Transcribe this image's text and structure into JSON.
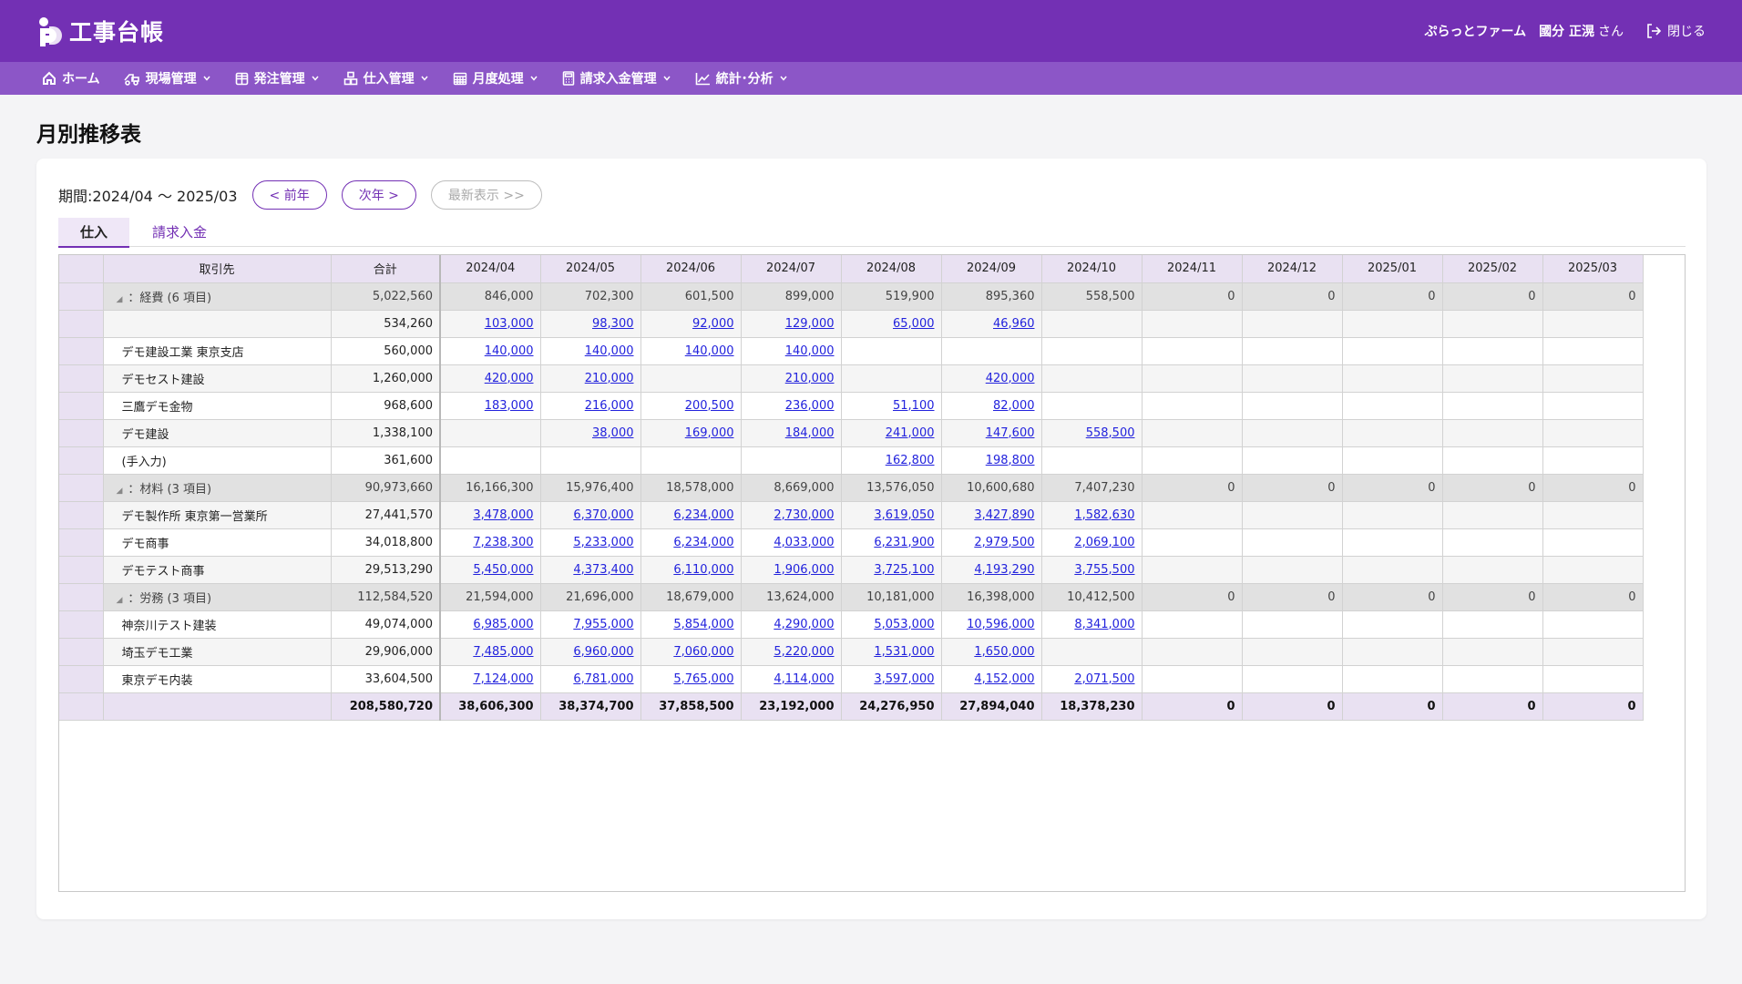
{
  "app": {
    "title": "工事台帳"
  },
  "user": {
    "company": "ぷらっとファーム",
    "name": "國分 正滉",
    "honorific": "さん",
    "logout_label": "閉じる"
  },
  "nav": [
    {
      "label": "ホーム",
      "icon": "home-icon",
      "has_menu": false
    },
    {
      "label": "現場管理",
      "icon": "truck-icon",
      "has_menu": true
    },
    {
      "label": "発注管理",
      "icon": "grid-icon",
      "has_menu": true
    },
    {
      "label": "仕入管理",
      "icon": "boxes-icon",
      "has_menu": true
    },
    {
      "label": "月度処理",
      "icon": "calendar-icon",
      "has_menu": true
    },
    {
      "label": "請求入金管理",
      "icon": "calculator-icon",
      "has_menu": true
    },
    {
      "label": "統計･分析",
      "icon": "chart-icon",
      "has_menu": true
    }
  ],
  "page": {
    "title": "月別推移表"
  },
  "controls": {
    "period": "期間:2024/04 ～ 2025/03",
    "prev_year": "< 前年",
    "next_year": "次年 >",
    "latest": "最新表示 >>"
  },
  "tabs": [
    {
      "label": "仕入",
      "active": true
    },
    {
      "label": "請求入金",
      "active": false
    }
  ],
  "table": {
    "headers": [
      "取引先",
      "合計",
      "2024/04",
      "2024/05",
      "2024/06",
      "2024/07",
      "2024/08",
      "2024/09",
      "2024/10",
      "2024/11",
      "2024/12",
      "2025/01",
      "2025/02",
      "2025/03"
    ],
    "rows": [
      {
        "type": "group",
        "name": "：経費 (6 項目)",
        "total": "5,022,560",
        "months": [
          "846,000",
          "702,300",
          "601,500",
          "899,000",
          "519,900",
          "895,360",
          "558,500",
          "0",
          "0",
          "0",
          "0",
          "0"
        ]
      },
      {
        "type": "item",
        "name": "",
        "total": "534,260",
        "months": [
          "103,000",
          "98,300",
          "92,000",
          "129,000",
          "65,000",
          "46,960",
          "",
          "",
          "",
          "",
          "",
          ""
        ]
      },
      {
        "type": "item",
        "name": "デモ建設工業 東京支店",
        "total": "560,000",
        "months": [
          "140,000",
          "140,000",
          "140,000",
          "140,000",
          "",
          "",
          "",
          "",
          "",
          "",
          "",
          ""
        ]
      },
      {
        "type": "item",
        "name": "デモセスト建設",
        "total": "1,260,000",
        "months": [
          "420,000",
          "210,000",
          "",
          "210,000",
          "",
          "420,000",
          "",
          "",
          "",
          "",
          "",
          ""
        ]
      },
      {
        "type": "item",
        "name": "三鷹デモ金物",
        "total": "968,600",
        "months": [
          "183,000",
          "216,000",
          "200,500",
          "236,000",
          "51,100",
          "82,000",
          "",
          "",
          "",
          "",
          "",
          ""
        ]
      },
      {
        "type": "item",
        "name": "デモ建設",
        "total": "1,338,100",
        "months": [
          "",
          "38,000",
          "169,000",
          "184,000",
          "241,000",
          "147,600",
          "558,500",
          "",
          "",
          "",
          "",
          ""
        ]
      },
      {
        "type": "item",
        "name": "(手入力)",
        "total": "361,600",
        "months": [
          "",
          "",
          "",
          "",
          "162,800",
          "198,800",
          "",
          "",
          "",
          "",
          "",
          ""
        ]
      },
      {
        "type": "group",
        "name": "：材料 (3 項目)",
        "total": "90,973,660",
        "months": [
          "16,166,300",
          "15,976,400",
          "18,578,000",
          "8,669,000",
          "13,576,050",
          "10,600,680",
          "7,407,230",
          "0",
          "0",
          "0",
          "0",
          "0"
        ]
      },
      {
        "type": "item",
        "name": "デモ製作所 東京第一営業所",
        "total": "27,441,570",
        "months": [
          "3,478,000",
          "6,370,000",
          "6,234,000",
          "2,730,000",
          "3,619,050",
          "3,427,890",
          "1,582,630",
          "",
          "",
          "",
          "",
          ""
        ]
      },
      {
        "type": "item",
        "name": "デモ商事",
        "total": "34,018,800",
        "months": [
          "7,238,300",
          "5,233,000",
          "6,234,000",
          "4,033,000",
          "6,231,900",
          "2,979,500",
          "2,069,100",
          "",
          "",
          "",
          "",
          ""
        ]
      },
      {
        "type": "item",
        "name": "デモテスト商事",
        "total": "29,513,290",
        "months": [
          "5,450,000",
          "4,373,400",
          "6,110,000",
          "1,906,000",
          "3,725,100",
          "4,193,290",
          "3,755,500",
          "",
          "",
          "",
          "",
          ""
        ]
      },
      {
        "type": "group",
        "name": "：労務 (3 項目)",
        "total": "112,584,520",
        "months": [
          "21,594,000",
          "21,696,000",
          "18,679,000",
          "13,624,000",
          "10,181,000",
          "16,398,000",
          "10,412,500",
          "0",
          "0",
          "0",
          "0",
          "0"
        ]
      },
      {
        "type": "item",
        "name": "神奈川テスト建装",
        "total": "49,074,000",
        "months": [
          "6,985,000",
          "7,955,000",
          "5,854,000",
          "4,290,000",
          "5,053,000",
          "10,596,000",
          "8,341,000",
          "",
          "",
          "",
          "",
          ""
        ]
      },
      {
        "type": "item",
        "name": "埼玉デモ工業",
        "total": "29,906,000",
        "months": [
          "7,485,000",
          "6,960,000",
          "7,060,000",
          "5,220,000",
          "1,531,000",
          "1,650,000",
          "",
          "",
          "",
          "",
          "",
          ""
        ]
      },
      {
        "type": "item",
        "name": "東京デモ内装",
        "total": "33,604,500",
        "months": [
          "7,124,000",
          "6,781,000",
          "5,765,000",
          "4,114,000",
          "3,597,000",
          "4,152,000",
          "2,071,500",
          "",
          "",
          "",
          "",
          ""
        ]
      },
      {
        "type": "total",
        "name": "",
        "total": "208,580,720",
        "months": [
          "38,606,300",
          "38,374,700",
          "37,858,500",
          "23,192,000",
          "24,276,950",
          "27,894,040",
          "18,378,230",
          "0",
          "0",
          "0",
          "0",
          "0"
        ]
      }
    ]
  },
  "colors": {
    "header": "#7330b4",
    "nav": "#8c56c7",
    "link": "#2222dd",
    "header_cell": "#e9e1f2",
    "group_row": "#e1e1e1"
  }
}
